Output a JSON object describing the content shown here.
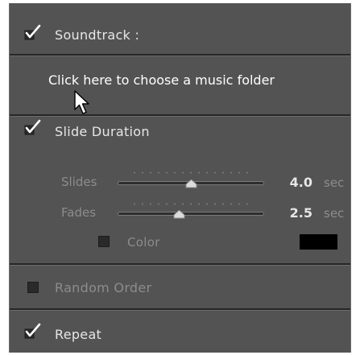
{
  "soundtrack": {
    "label": "Soundtrack :",
    "checked": true,
    "chooser_text": "Click here to choose a music folder"
  },
  "slide_duration": {
    "label": "Slide Duration",
    "checked": true,
    "slides": {
      "label": "Slides",
      "value": "4.0",
      "unit": "sec",
      "level": 0.5
    },
    "fades": {
      "label": "Fades",
      "value": "2.5",
      "unit": "sec",
      "level": 0.42
    },
    "color": {
      "label": "Color",
      "checked": false,
      "swatch_color": "#000000"
    }
  },
  "random_order": {
    "label": "Random Order",
    "checked": false
  },
  "repeat": {
    "label": "Repeat",
    "checked": true
  },
  "colors": {
    "panel_bg": "#535353",
    "text": "#e6e6e6",
    "dim_text": "#8c8c8c"
  }
}
